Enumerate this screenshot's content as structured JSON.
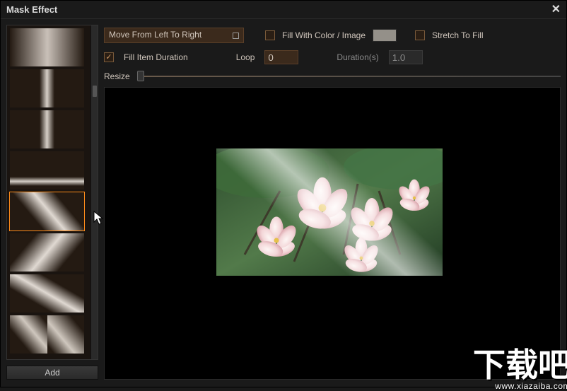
{
  "title": "Mask Effect",
  "dropdown": {
    "value": "Move From Left To Right"
  },
  "fillWithColor": {
    "label": "Fill With Color / Image",
    "checked": false
  },
  "stretch": {
    "label": "Stretch To Fill",
    "checked": false
  },
  "fillItemDuration": {
    "label": "Fill Item Duration",
    "checked": true
  },
  "loop": {
    "label": "Loop",
    "value": "0"
  },
  "duration": {
    "label": "Duration(s)",
    "value": "1.0"
  },
  "resize": {
    "label": "Resize"
  },
  "addBtn": "Add",
  "watermark": {
    "big": "下载吧",
    "small": "www.xiazaiba.com"
  },
  "colors": {
    "swatch": "#949089"
  }
}
